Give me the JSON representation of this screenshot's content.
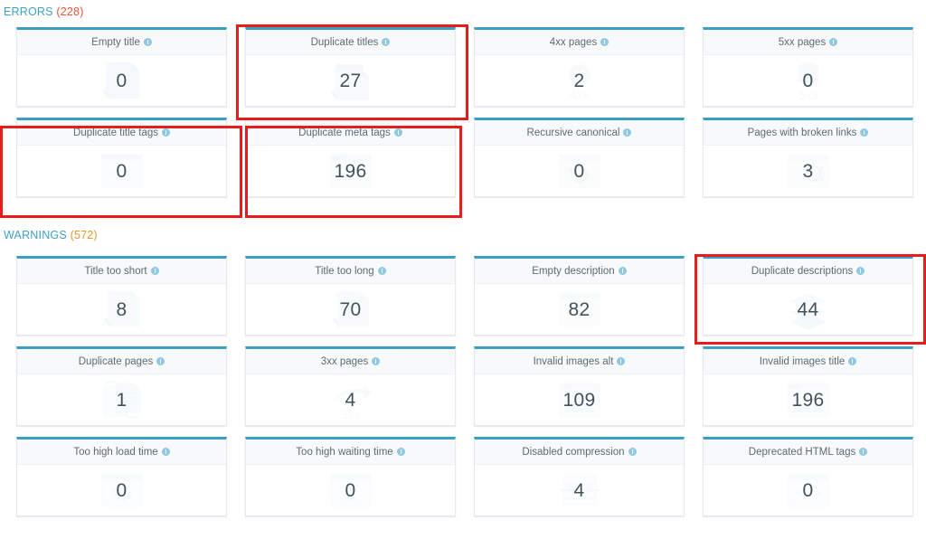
{
  "sections": [
    {
      "id": "errors",
      "label": "ERRORS",
      "count": "(228)",
      "count_color": "#e8533f",
      "cards": [
        {
          "title": "Empty title",
          "value": "0",
          "icon": "tag-icon",
          "highlighted": false
        },
        {
          "title": "Duplicate titles",
          "value": "27",
          "icon": "duplicate-tag-icon",
          "highlighted": true
        },
        {
          "title": "4xx pages",
          "value": "2",
          "icon": "4xx-error-icon",
          "highlighted": false
        },
        {
          "title": "5xx pages",
          "value": "0",
          "icon": "5xx-server-icon",
          "highlighted": false
        },
        {
          "title": "Duplicate title tags",
          "value": "0",
          "icon": "code-tag-icon",
          "highlighted": true
        },
        {
          "title": "Duplicate meta tags",
          "value": "196",
          "icon": "browser-window-icon",
          "highlighted": true
        },
        {
          "title": "Recursive canonical",
          "value": "0",
          "icon": "refresh-window-icon",
          "highlighted": false
        },
        {
          "title": "Pages with broken links",
          "value": "3",
          "icon": "broken-link-icon",
          "highlighted": false
        }
      ]
    },
    {
      "id": "warnings",
      "label": "WARNINGS",
      "count": "(572)",
      "count_color": "#f0942e",
      "cards": [
        {
          "title": "Title too short",
          "value": "8",
          "icon": "short-tag-icon",
          "highlighted": false
        },
        {
          "title": "Title too long",
          "value": "70",
          "icon": "long-tag-icon",
          "highlighted": false
        },
        {
          "title": "Empty description",
          "value": "82",
          "icon": "browser-window-icon",
          "highlighted": false
        },
        {
          "title": "Duplicate descriptions",
          "value": "44",
          "icon": "stacked-layers-icon",
          "highlighted": true
        },
        {
          "title": "Duplicate pages",
          "value": "1",
          "icon": "duplicate-pages-icon",
          "highlighted": false
        },
        {
          "title": "3xx pages",
          "value": "4",
          "icon": "3xx-redirect-icon",
          "highlighted": false
        },
        {
          "title": "Invalid images alt",
          "value": "109",
          "icon": "image-window-icon",
          "highlighted": false
        },
        {
          "title": "Invalid images title",
          "value": "196",
          "icon": "image-window-icon",
          "highlighted": false
        },
        {
          "title": "Too high load time",
          "value": "0",
          "icon": "loading-window-icon",
          "highlighted": false
        },
        {
          "title": "Too high waiting time",
          "value": "0",
          "icon": "hourglass-window-icon",
          "highlighted": false
        },
        {
          "title": "Disabled compression",
          "value": "4",
          "icon": "compress-arrows-icon",
          "highlighted": false
        },
        {
          "title": "Deprecated HTML tags",
          "value": "0",
          "icon": "html-tag-window-icon",
          "highlighted": false
        }
      ]
    }
  ],
  "theme": {
    "card_top_accent": "#3a9fc4",
    "highlight_color": "#e81c1c",
    "heading_color": "#3fa0c4",
    "value_color": "#42525c"
  }
}
